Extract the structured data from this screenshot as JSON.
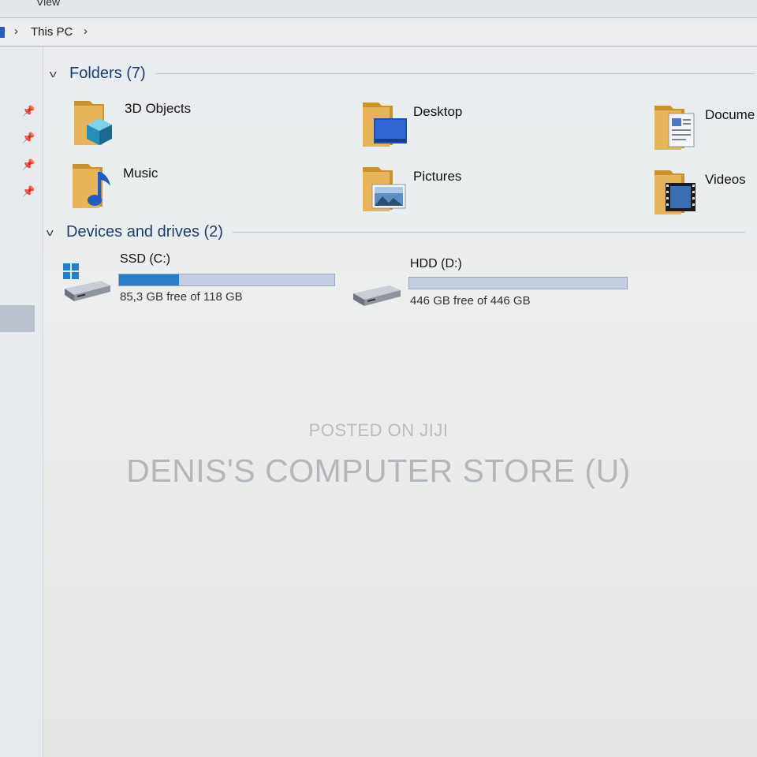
{
  "ribbon": {
    "view_tab": "View"
  },
  "address": {
    "location": "This PC"
  },
  "folders_group": {
    "title": "Folders (7)",
    "items": [
      {
        "label": "3D Objects",
        "icon": "3d-objects-folder-icon"
      },
      {
        "label": "Desktop",
        "icon": "desktop-folder-icon"
      },
      {
        "label": "Docume",
        "icon": "documents-folder-icon"
      },
      {
        "label": "Music",
        "icon": "music-folder-icon"
      },
      {
        "label": "Pictures",
        "icon": "pictures-folder-icon"
      },
      {
        "label": "Videos",
        "icon": "videos-folder-icon"
      }
    ]
  },
  "drives_group": {
    "title": "Devices and drives (2)",
    "items": [
      {
        "name": "SSD (C:)",
        "free_text": "85,3 GB free of 118 GB",
        "used_fraction": 0.28,
        "icon": "windows-drive-icon"
      },
      {
        "name": "HDD (D:)",
        "free_text": "446 GB free of 446 GB",
        "used_fraction": 0.0,
        "icon": "hard-drive-icon"
      }
    ]
  },
  "watermark": {
    "line1": "POSTED ON JIJI",
    "line2": "DENIS'S COMPUTER STORE (U)"
  },
  "colors": {
    "accent": "#2a7bc8",
    "bar_track": "#c5cde0",
    "folder": "#e2b253",
    "group_title": "#1e3d6b"
  }
}
